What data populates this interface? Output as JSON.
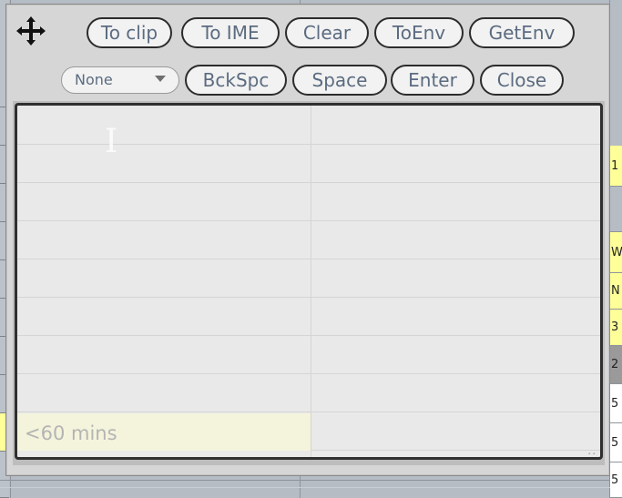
{
  "dialog": {
    "move_handle_icon": "move-cross-icon",
    "toolbar": {
      "row1": [
        {
          "label": "To clip",
          "name": "to-clip-button"
        },
        {
          "label": "To IME",
          "name": "to-ime-button"
        },
        {
          "label": "Clear",
          "name": "clear-button"
        },
        {
          "label": "ToEnv",
          "name": "to-env-button"
        },
        {
          "label": "GetEnv",
          "name": "get-env-button"
        }
      ],
      "row2_dropdown": {
        "name": "mode-dropdown",
        "value": "None",
        "chevron_icon": "chevron-down-icon"
      },
      "row2": [
        {
          "label": "BckSpc",
          "name": "backspace-button"
        },
        {
          "label": "Space",
          "name": "space-button"
        },
        {
          "label": "Enter",
          "name": "enter-button"
        },
        {
          "label": "Close",
          "name": "close-button"
        }
      ]
    },
    "editor": {
      "name": "text-entry-grid",
      "caret_glyph": "I",
      "highlighted_cell_text": "<60 mins",
      "resize_grip_icon": "resize-grip-icon"
    }
  },
  "colors": {
    "dialog_face": "#d6d6d6",
    "button_text": "#5b6b80",
    "button_face": "#f2f2f2",
    "button_border": "#2c2c2c",
    "editor_face": "#e9e9e9",
    "grid_line": "#d5d5d5",
    "highlight_cell": "#f4f4dc",
    "highlight_text": "#b4b4b4",
    "sheet_highlight": "#ffff99",
    "sheet_face": "#b6bcc4"
  },
  "background_sheet": {
    "name": "spreadsheet-behind-dialog",
    "right_column_cells": [
      {
        "text": "1",
        "fill": "#ffff99"
      },
      {
        "text": "",
        "fill": "#b6bcc4"
      },
      {
        "text": "W",
        "fill": "#ffff99"
      },
      {
        "text": "N",
        "fill": "#ffff99"
      },
      {
        "text": "3",
        "fill": "#ffff99"
      },
      {
        "text": "2",
        "fill": "#9a9a9a"
      },
      {
        "text": "5",
        "fill": "#ffffff"
      },
      {
        "text": "5",
        "fill": "#ffffff"
      },
      {
        "text": "5",
        "fill": "#ffffff"
      }
    ]
  }
}
